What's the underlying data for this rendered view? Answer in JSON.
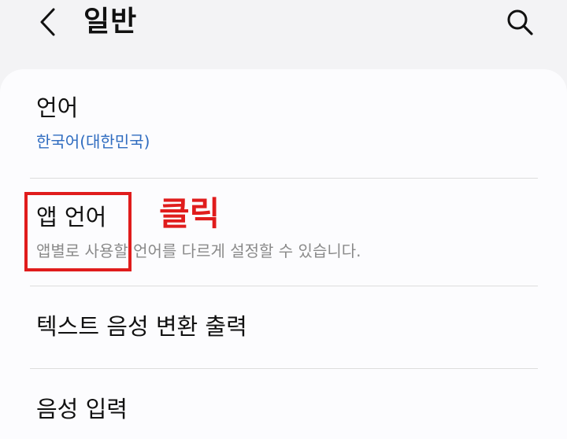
{
  "header": {
    "title": "일반",
    "back_icon": "chevron-left-icon",
    "search_icon": "search-icon"
  },
  "settings": {
    "language": {
      "title": "언어",
      "value": "한국어(대한민국)"
    },
    "app_language": {
      "title": "앱 언어",
      "description": "앱별로 사용할 언어를 다르게 설정할 수 있습니다."
    },
    "tts": {
      "title": "텍스트 음성 변환 출력"
    },
    "voice_input": {
      "title": "음성 입력"
    }
  },
  "annotation": {
    "label": "클릭"
  },
  "colors": {
    "link_blue": "#2f6cc0",
    "annotation_red": "#e01c1c",
    "description_gray": "#8a8a8a"
  }
}
